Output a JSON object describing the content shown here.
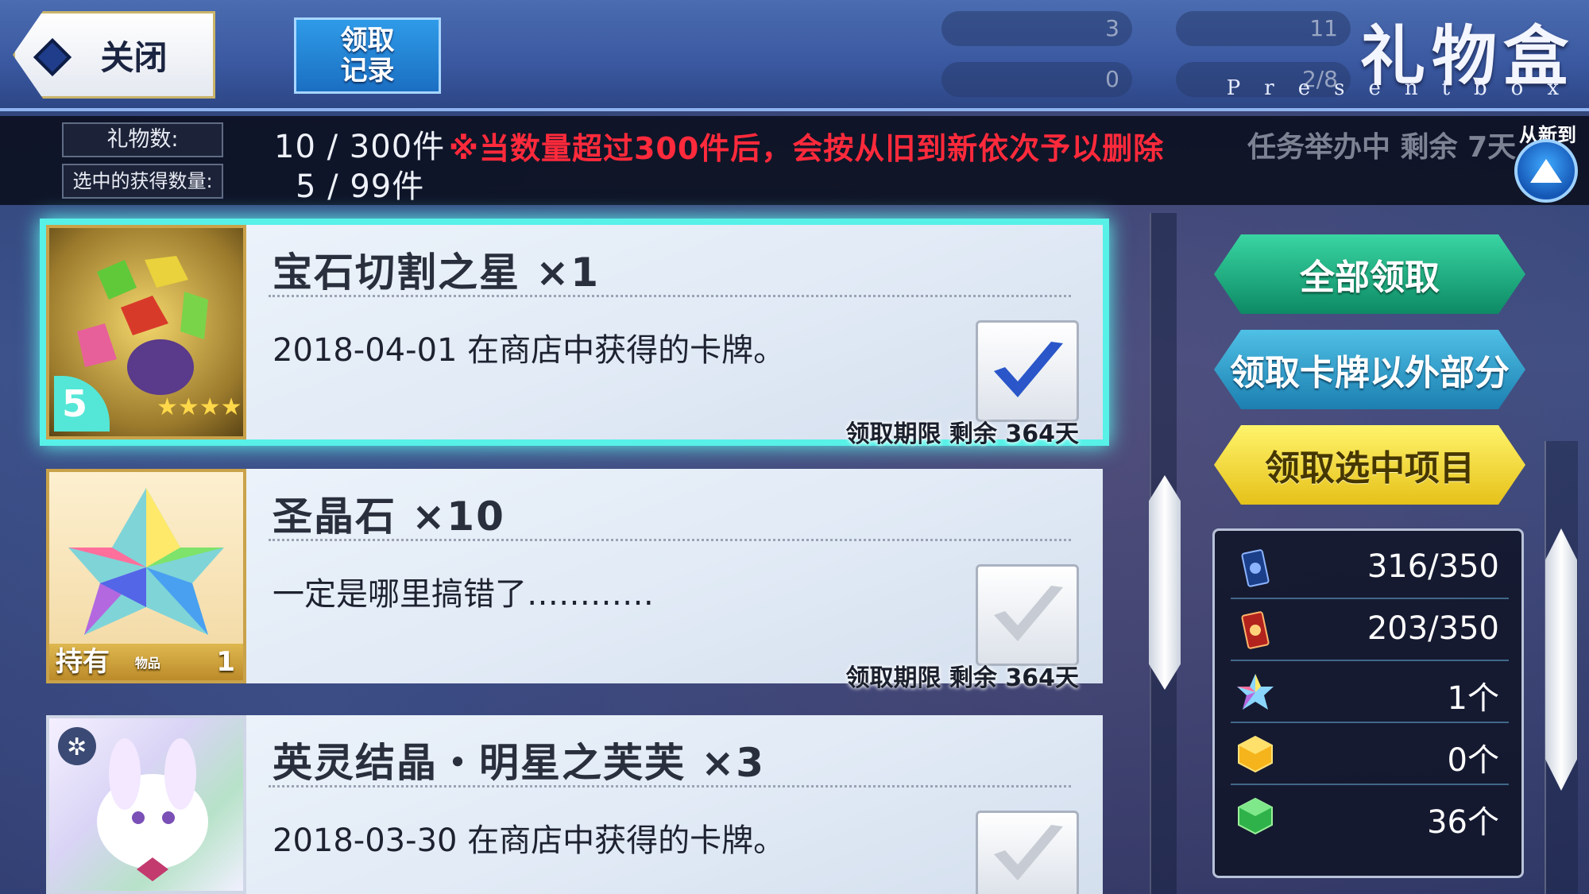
{
  "header": {
    "close_label": "关闭",
    "record_label_line1": "领取",
    "record_label_line2": "记录",
    "title": "礼物盒",
    "title_en": "Presentbox",
    "ghost_stats": [
      "3",
      "11",
      "0",
      "2/8"
    ]
  },
  "info": {
    "gift_count_label": "礼物数:",
    "gift_count_value": "10 / 300件",
    "selected_count_label": "选中的获得数量:",
    "selected_count_value": "5 /  99件",
    "warning": "※当数量超过300件后，会按从旧到新依次予以删除",
    "event_text": "任务举办中 剩余 7天",
    "sort_label": "从新到旧"
  },
  "gifts": [
    {
      "name": "宝石切割之星  ×1",
      "desc": "2018-04-01 在商店中获得的卡牌。",
      "expire": "领取期限 剩余 364天",
      "thumb_count": "5",
      "checked": true
    },
    {
      "name": "圣晶石  ×10",
      "desc": "一定是哪里搞错了…………",
      "expire": "领取期限 剩余 364天",
      "owned_label": "持有",
      "owned_tag": "物品",
      "owned_count": "1",
      "checked": false
    },
    {
      "name": "英灵结晶・明星之芙芙  ×3",
      "desc": "2018-03-30 在商店中获得的卡牌。",
      "checked": false
    }
  ],
  "actions": {
    "receive_all": "全部领取",
    "receive_non_card": "领取卡牌以外部分",
    "receive_selected": "领取选中项目"
  },
  "resources": [
    {
      "icon": "servant-card-icon",
      "value": "316/350"
    },
    {
      "icon": "craft-essence-card-icon",
      "value": "203/350"
    },
    {
      "icon": "saint-quartz-icon",
      "value": "1个"
    },
    {
      "icon": "golden-apple-icon",
      "value": "0个"
    },
    {
      "icon": "bronze-apple-icon",
      "value": "36个"
    }
  ],
  "colors": {
    "selected_border": "#57f1e8",
    "warning": "#ff2a3b",
    "receive_all": "#0d8a64",
    "receive_non_card": "#1c7fb0",
    "receive_selected": "#e6c11a"
  }
}
